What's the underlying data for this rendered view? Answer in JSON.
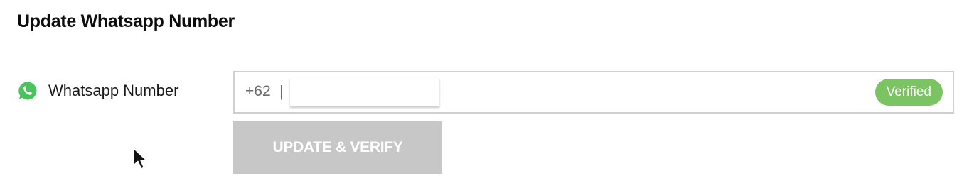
{
  "page": {
    "title": "Update Whatsapp Number"
  },
  "field": {
    "label": "Whatsapp Number",
    "icon": "whatsapp-icon",
    "country_code": "+62",
    "separator": "|",
    "value": "",
    "placeholder": ""
  },
  "status": {
    "badge": "Verified",
    "color": "#7cc364"
  },
  "actions": {
    "update_label": "UPDATE & VERIFY"
  },
  "colors": {
    "whatsapp_green": "#4ac25e",
    "button_disabled": "#c7c7c7",
    "border": "#d0d0d0"
  }
}
